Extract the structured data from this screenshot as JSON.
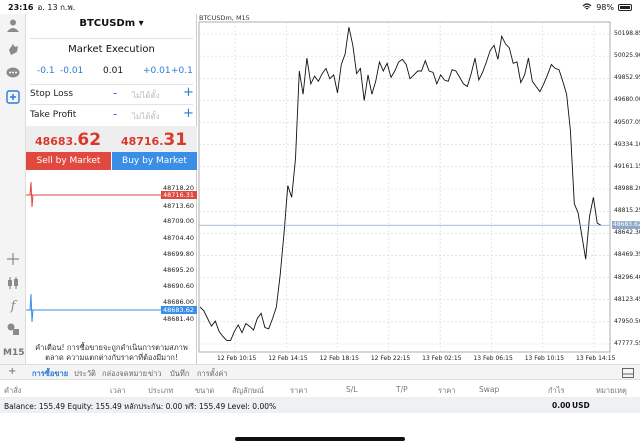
{
  "status": {
    "time": "23:16",
    "date": "อ. 13 ก.พ.",
    "battery": "98%",
    "wifi_icon": "wifi-icon"
  },
  "order": {
    "symbol": "BTCUSDm ▾",
    "execution": "Market Execution",
    "volume": {
      "minus_big": "-0.1",
      "minus_small": "-0.01",
      "value": "0.01",
      "plus_small": "+0.01",
      "plus_big": "+0.1"
    },
    "stop_loss": {
      "label": "Stop Loss",
      "minus": "-",
      "value": "ไม่ได้ตั้ง",
      "plus": "+"
    },
    "take_profit": {
      "label": "Take Profit",
      "minus": "-",
      "value": "ไม่ได้ตั้ง",
      "plus": "+"
    },
    "bid": {
      "main": "48683.",
      "big": "62"
    },
    "ask": {
      "main": "48716.",
      "big": "31"
    },
    "sell_label": "Sell by Market",
    "buy_label": "Buy by Market",
    "tick_scale": [
      "48718.20",
      "48713.60",
      "48709.00",
      "48704.40",
      "48699.80",
      "48695.20",
      "48690.60",
      "48686.00",
      "48681.40"
    ],
    "ask_tag": "48716.31",
    "bid_tag": "48683.62",
    "warning": "คำเตือน! การซื้อขายจะถูกดำเนินการตามสภาพตลาด ความแตกต่างกับราคาที่ต้องมีมาก!"
  },
  "left_tools": [
    "user-icon",
    "hand-icon",
    "chat-icon",
    "add-order-icon"
  ],
  "left_tools_bottom": [
    "crosshair-icon",
    "vertical-line-icon",
    "fibonacci-icon",
    "function-icon",
    "objects-icon"
  ],
  "timeframe": "M15",
  "chart": {
    "label": "BTCUSDm, M15",
    "current_price_tag": "48683.62",
    "accent_line_color": "#8da9c9"
  },
  "chart_data": {
    "type": "line",
    "title": "BTCUSDm, M15",
    "xlabel": "",
    "ylabel": "",
    "x_ticks": [
      "12 Feb 10:15",
      "12 Feb 14:15",
      "12 Feb 18:15",
      "12 Feb 22:15",
      "13 Feb 02:15",
      "13 Feb 06:15",
      "13 Feb 10:15",
      "13 Feb 14:15"
    ],
    "y_ticks": [
      "50198.85",
      "50025.90",
      "49852.95",
      "49680.00",
      "49507.05",
      "49334.10",
      "49161.15",
      "48988.20",
      "48815.25",
      "48642.30",
      "48469.35",
      "48296.40",
      "48123.45",
      "47950.50",
      "47777.55"
    ],
    "ylim": [
      47700,
      50260
    ],
    "grid": true,
    "series": [
      {
        "values": [
          48050,
          48020,
          47960,
          47900,
          47940,
          47860,
          47820,
          47790,
          47790,
          47860,
          47910,
          47850,
          47920,
          47900,
          47870,
          47960,
          48000,
          47890,
          47880,
          47960,
          48050,
          48300,
          48620,
          48990,
          48900,
          49200,
          49880,
          49700,
          49980,
          49780,
          49840,
          49800,
          49860,
          49900,
          49820,
          49850,
          49710,
          49930,
          50010,
          50220,
          50080,
          49860,
          49900,
          49650,
          49850,
          49700,
          49800,
          49950,
          49880,
          49940,
          49830,
          49880,
          49950,
          49970,
          49930,
          49820,
          49850,
          49880,
          49880,
          49960,
          49880,
          49870,
          49780,
          49850,
          49810,
          49800,
          49890,
          49880,
          49830,
          49780,
          49760,
          49860,
          49980,
          49810,
          49870,
          49950,
          50040,
          50080,
          49970,
          50150,
          50090,
          50060,
          49940,
          49950,
          49790,
          49850,
          49980,
          49800,
          49760,
          49720,
          49780,
          49850,
          49930,
          49900,
          49890,
          49800,
          49700,
          49420,
          48850,
          48780,
          48600,
          48420,
          48750,
          48900,
          48700,
          48683
        ]
      }
    ]
  },
  "tabs": [
    "การซื้อขาย",
    "ประวัติ",
    "กล่องจดหมาย",
    "ข่าว",
    "บันทึก",
    "การตั้งค่า"
  ],
  "columns": [
    "คำสั่ง",
    "เวลา",
    "ประเภท",
    "ขนาด",
    "สัญลักษณ์",
    "ราคา",
    "S/L",
    "T/P",
    "ราคา",
    "Swap",
    "กำไร",
    "หมายเหตุ"
  ],
  "balance": {
    "text": "Balance: 155.49 Equity: 155.49 หลักประกัน: 0.00 ฟรี: 155.49 Level: 0.00%",
    "amount": "0.00",
    "currency": "USD"
  }
}
